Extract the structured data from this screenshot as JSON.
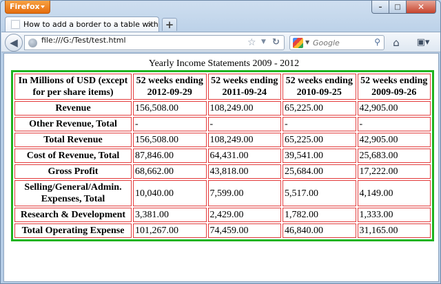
{
  "app": {
    "menu_button": "Firefox",
    "caption": {
      "minimize": "–",
      "maximize": "□",
      "close": "✕"
    }
  },
  "tabs": [
    {
      "title": "How to add a border to a table with CSS"
    }
  ],
  "newtab_label": "+",
  "navbar": {
    "url": "file:///G:/Test/test.html",
    "search_placeholder": "Google"
  },
  "icons": {
    "back": "back-arrow-icon",
    "site": "globe-icon",
    "bookmark": "star-icon",
    "reload": "reload-icon",
    "search_engine": "google-icon",
    "search_go": "magnifier-icon",
    "home": "home-icon",
    "bookmarks_menu": "bookmarks-icon"
  },
  "colors": {
    "table_outer_border": "#1fb41f",
    "cell_border": "#e23a3a",
    "firefox_button": "#e66d0d"
  },
  "table": {
    "caption": "Yearly Income Statements 2009 - 2012",
    "header": [
      "In Millions of USD (except for per share items)",
      "52 weeks ending 2012-09-29",
      "52 weeks ending 2011-09-24",
      "52 weeks ending 2010-09-25",
      "52 weeks ending 2009-09-26"
    ],
    "rows": [
      {
        "label": "Revenue",
        "values": [
          "156,508.00",
          "108,249.00",
          "65,225.00",
          "42,905.00"
        ]
      },
      {
        "label": "Other Revenue, Total",
        "values": [
          "-",
          "-",
          "-",
          "-"
        ]
      },
      {
        "label": "Total Revenue",
        "values": [
          "156,508.00",
          "108,249.00",
          "65,225.00",
          "42,905.00"
        ]
      },
      {
        "label": "Cost of Revenue, Total",
        "values": [
          "87,846.00",
          "64,431.00",
          "39,541.00",
          "25,683.00"
        ]
      },
      {
        "label": "Gross Profit",
        "values": [
          "68,662.00",
          "43,818.00",
          "25,684.00",
          "17,222.00"
        ]
      },
      {
        "label": "Selling/General/Admin. Expenses, Total",
        "values": [
          "10,040.00",
          "7,599.00",
          "5,517.00",
          "4,149.00"
        ]
      },
      {
        "label": "Research & Development",
        "values": [
          "3,381.00",
          "2,429.00",
          "1,782.00",
          "1,333.00"
        ]
      },
      {
        "label": "Total Operating Expense",
        "values": [
          "101,267.00",
          "74,459.00",
          "46,840.00",
          "31,165.00"
        ]
      }
    ]
  }
}
